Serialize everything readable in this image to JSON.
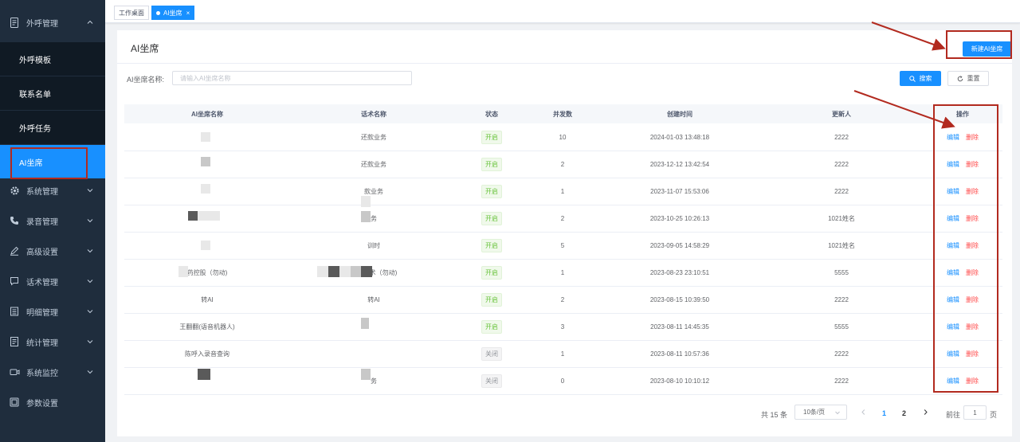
{
  "sidebar": {
    "groups": [
      {
        "label": "外呼管理",
        "icon": "document-icon",
        "expanded": true
      },
      {
        "label": "系统管理",
        "icon": "gear-icon"
      },
      {
        "label": "录音管理",
        "icon": "phone-icon"
      },
      {
        "label": "高级设置",
        "icon": "pen-icon"
      },
      {
        "label": "话术管理",
        "icon": "chat-icon"
      },
      {
        "label": "明细管理",
        "icon": "list-icon"
      },
      {
        "label": "统计管理",
        "icon": "report-icon"
      },
      {
        "label": "系统监控",
        "icon": "video-icon"
      },
      {
        "label": "参数设置",
        "icon": "settings-doc-icon"
      }
    ],
    "sub_items": [
      "外呼模板",
      "联系名单",
      "外呼任务",
      "AI坐席"
    ],
    "active_item": "AI坐席"
  },
  "tabs": [
    {
      "label": "工作桌面",
      "active": false
    },
    {
      "label": "AI坐席",
      "active": true
    }
  ],
  "page": {
    "title": "AI坐席",
    "new_button": "新建AI坐席",
    "filter_label": "AI坐席名称:",
    "filter_placeholder": "请输入AI坐席名称",
    "search_button": "搜索",
    "reset_button": "重置"
  },
  "table": {
    "columns": [
      "AI坐席名称",
      "话术名称",
      "状态",
      "并发数",
      "创建时间",
      "更新人",
      "操作"
    ],
    "rows": [
      {
        "name": "",
        "script": "还款业务",
        "status": "开启",
        "concurrency": "10",
        "created": "2024-01-03 13:48:18",
        "updater": "2222"
      },
      {
        "name": "",
        "script": "还款业务",
        "status": "开启",
        "concurrency": "2",
        "created": "2023-12-12 13:42:54",
        "updater": "2222"
      },
      {
        "name": "",
        "script": "款业务",
        "status": "开启",
        "concurrency": "1",
        "created": "2023-11-07 15:53:06",
        "updater": "2222"
      },
      {
        "name": "",
        "script": "务",
        "status": "开启",
        "concurrency": "2",
        "created": "2023-10-25 10:26:13",
        "updater": "1021姓名"
      },
      {
        "name": "时",
        "script": "训时",
        "status": "开启",
        "concurrency": "5",
        "created": "2023-09-05 14:58:29",
        "updater": "1021姓名"
      },
      {
        "name": "药控股（勿动)",
        "script": "催收话术（勿动)",
        "status": "开启",
        "concurrency": "1",
        "created": "2023-08-23 23:10:51",
        "updater": "5555"
      },
      {
        "name": "转AI",
        "script": "转AI",
        "status": "开启",
        "concurrency": "2",
        "created": "2023-08-15 10:39:50",
        "updater": "2222"
      },
      {
        "name": "王翻翻(语音机器人)",
        "script": "",
        "status": "开启",
        "concurrency": "3",
        "created": "2023-08-11 14:45:35",
        "updater": "5555"
      },
      {
        "name": "陈呼入录音查询",
        "script": "",
        "status": "关闭",
        "concurrency": "1",
        "created": "2023-08-11 10:57:36",
        "updater": "2222"
      },
      {
        "name": "",
        "script": "务",
        "status": "关闭",
        "concurrency": "0",
        "created": "2023-08-10 10:10:12",
        "updater": "2222"
      }
    ],
    "op_edit": "编辑",
    "op_delete": "删除"
  },
  "pagination": {
    "total_text": "共 15 条",
    "page_size": "10条/页",
    "pages": [
      "1",
      "2"
    ],
    "current_page": "1",
    "goto_label": "前往",
    "goto_value": "1",
    "goto_suffix": "页"
  },
  "colors": {
    "sidebar_bg": "#1f2d3d",
    "submenu_bg": "#101a24",
    "primary": "#1890ff",
    "danger": "#ff4949",
    "success": "#67c23a",
    "annotation": "#b22a1f"
  }
}
